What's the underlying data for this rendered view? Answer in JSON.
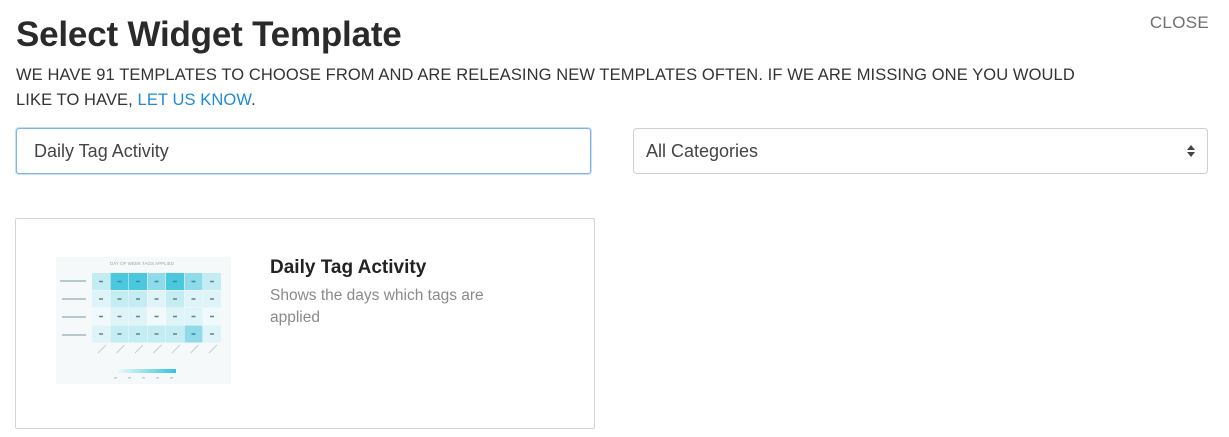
{
  "header": {
    "title": "Select Widget Template",
    "close_label": "CLOSE"
  },
  "intro": {
    "text_before_link": "WE HAVE 91 TEMPLATES TO CHOOSE FROM AND ARE RELEASING NEW TEMPLATES OFTEN. IF WE ARE MISSING ONE YOU WOULD LIKE TO HAVE,",
    "link_label": "LET US KNOW",
    "text_after_link": ".",
    "link_color": "#1f8ad8"
  },
  "filters": {
    "search_value": "Daily Tag Activity",
    "category_selected": "All Categories"
  },
  "results": [
    {
      "title": "Daily Tag Activity",
      "description": "Shows the days which tags are applied",
      "thumbnail": {
        "chart_title": "DAY OF WEEK TAGS APPLIED",
        "accent": "#35c3dc"
      }
    }
  ]
}
